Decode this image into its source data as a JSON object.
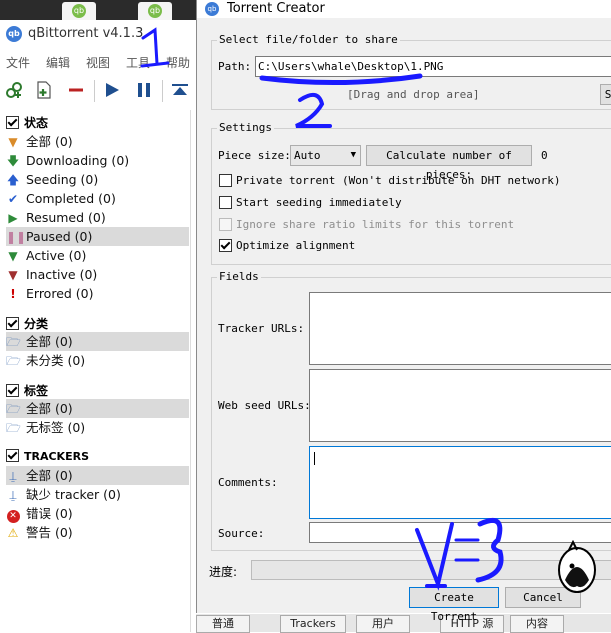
{
  "main_window": {
    "title": "qBittorrent v4.1.3",
    "logo_text": "qb",
    "desktop_icon_text": "qb",
    "menu": [
      "文件",
      "编辑",
      "视图",
      "工具",
      "帮助"
    ],
    "sidebar": {
      "status": {
        "header": "状态",
        "items": [
          {
            "label": "全部 (0)",
            "icon": "filter-icon",
            "color": "#d98b2a"
          },
          {
            "label": "Downloading (0)",
            "icon": "arrow-down-icon",
            "color": "#2e8b3a"
          },
          {
            "label": "Seeding (0)",
            "icon": "arrow-up-icon",
            "color": "#2a5fcf"
          },
          {
            "label": "Completed (0)",
            "icon": "check-icon",
            "color": "#2a5fcf"
          },
          {
            "label": "Resumed (0)",
            "icon": "play-icon",
            "color": "#2e8b3a"
          },
          {
            "label": "Paused (0)",
            "icon": "pause-icon",
            "color": "#c07fa0"
          },
          {
            "label": "Active (0)",
            "icon": "filter-active-icon",
            "color": "#2e8b3a"
          },
          {
            "label": "Inactive (0)",
            "icon": "filter-inactive-icon",
            "color": "#a03030"
          },
          {
            "label": "Errored (0)",
            "icon": "exclamation-icon",
            "color": "#cc0000"
          }
        ],
        "selected": "Paused (0)"
      },
      "categories": {
        "header": "分类",
        "items": [
          {
            "label": "全部 (0)",
            "icon": "folder-icon"
          },
          {
            "label": "未分类 (0)",
            "icon": "folder-icon"
          }
        ],
        "selected": "全部 (0)"
      },
      "tags": {
        "header": "标签",
        "items": [
          {
            "label": "全部 (0)",
            "icon": "folder-icon"
          },
          {
            "label": "无标签 (0)",
            "icon": "folder-icon"
          }
        ],
        "selected": "全部 (0)"
      },
      "trackers": {
        "header": "TRACKERS",
        "items": [
          {
            "label": "全部 (0)",
            "icon": "tracker-icon"
          },
          {
            "label": "缺少 tracker (0)",
            "icon": "tracker-icon"
          },
          {
            "label": "错误 (0)",
            "icon": "error-icon"
          },
          {
            "label": "警告 (0)",
            "icon": "warning-icon"
          }
        ],
        "selected": "全部 (0)"
      }
    },
    "bottom_tabs": [
      "普通",
      "Trackers",
      "用户",
      "HTTP 源",
      "内容"
    ]
  },
  "dialog": {
    "title": "Torrent Creator",
    "logo_text": "qb",
    "file_group": {
      "title": "Select file/folder to share",
      "path_label": "Path:",
      "path_value": "C:\\Users\\whale\\Desktop\\1.PNG",
      "drop_hint": "[Drag and drop area]",
      "select_button_partial": "S"
    },
    "settings_group": {
      "title": "Settings",
      "piece_size_label": "Piece size:",
      "piece_size_value": "Auto",
      "calc_button": "Calculate number of pieces:",
      "pieces_count": "0",
      "options": [
        {
          "label": "Private torrent (Won't distribute on DHT network)",
          "checked": false,
          "enabled": true
        },
        {
          "label": "Start seeding immediately",
          "checked": false,
          "enabled": true
        },
        {
          "label": "Ignore share ratio limits for this torrent",
          "checked": false,
          "enabled": false
        },
        {
          "label": "Optimize alignment",
          "checked": true,
          "enabled": true
        }
      ]
    },
    "fields_group": {
      "title": "Fields",
      "tracker_label": "Tracker URLs:",
      "webseed_label": "Web seed URLs:",
      "comments_label": "Comments:",
      "source_label": "Source:"
    },
    "progress_label": "进度:",
    "progress_value": 0,
    "create_button": "Create Torrent",
    "cancel_button": "Cancel"
  },
  "annotations": [
    "1",
    "2",
    "3"
  ],
  "colors": {
    "annotation_blue": "#1a1aff",
    "selection_gray": "#dadada",
    "dialog_bg": "#f0f0f0",
    "focus_blue": "#0078d7"
  }
}
